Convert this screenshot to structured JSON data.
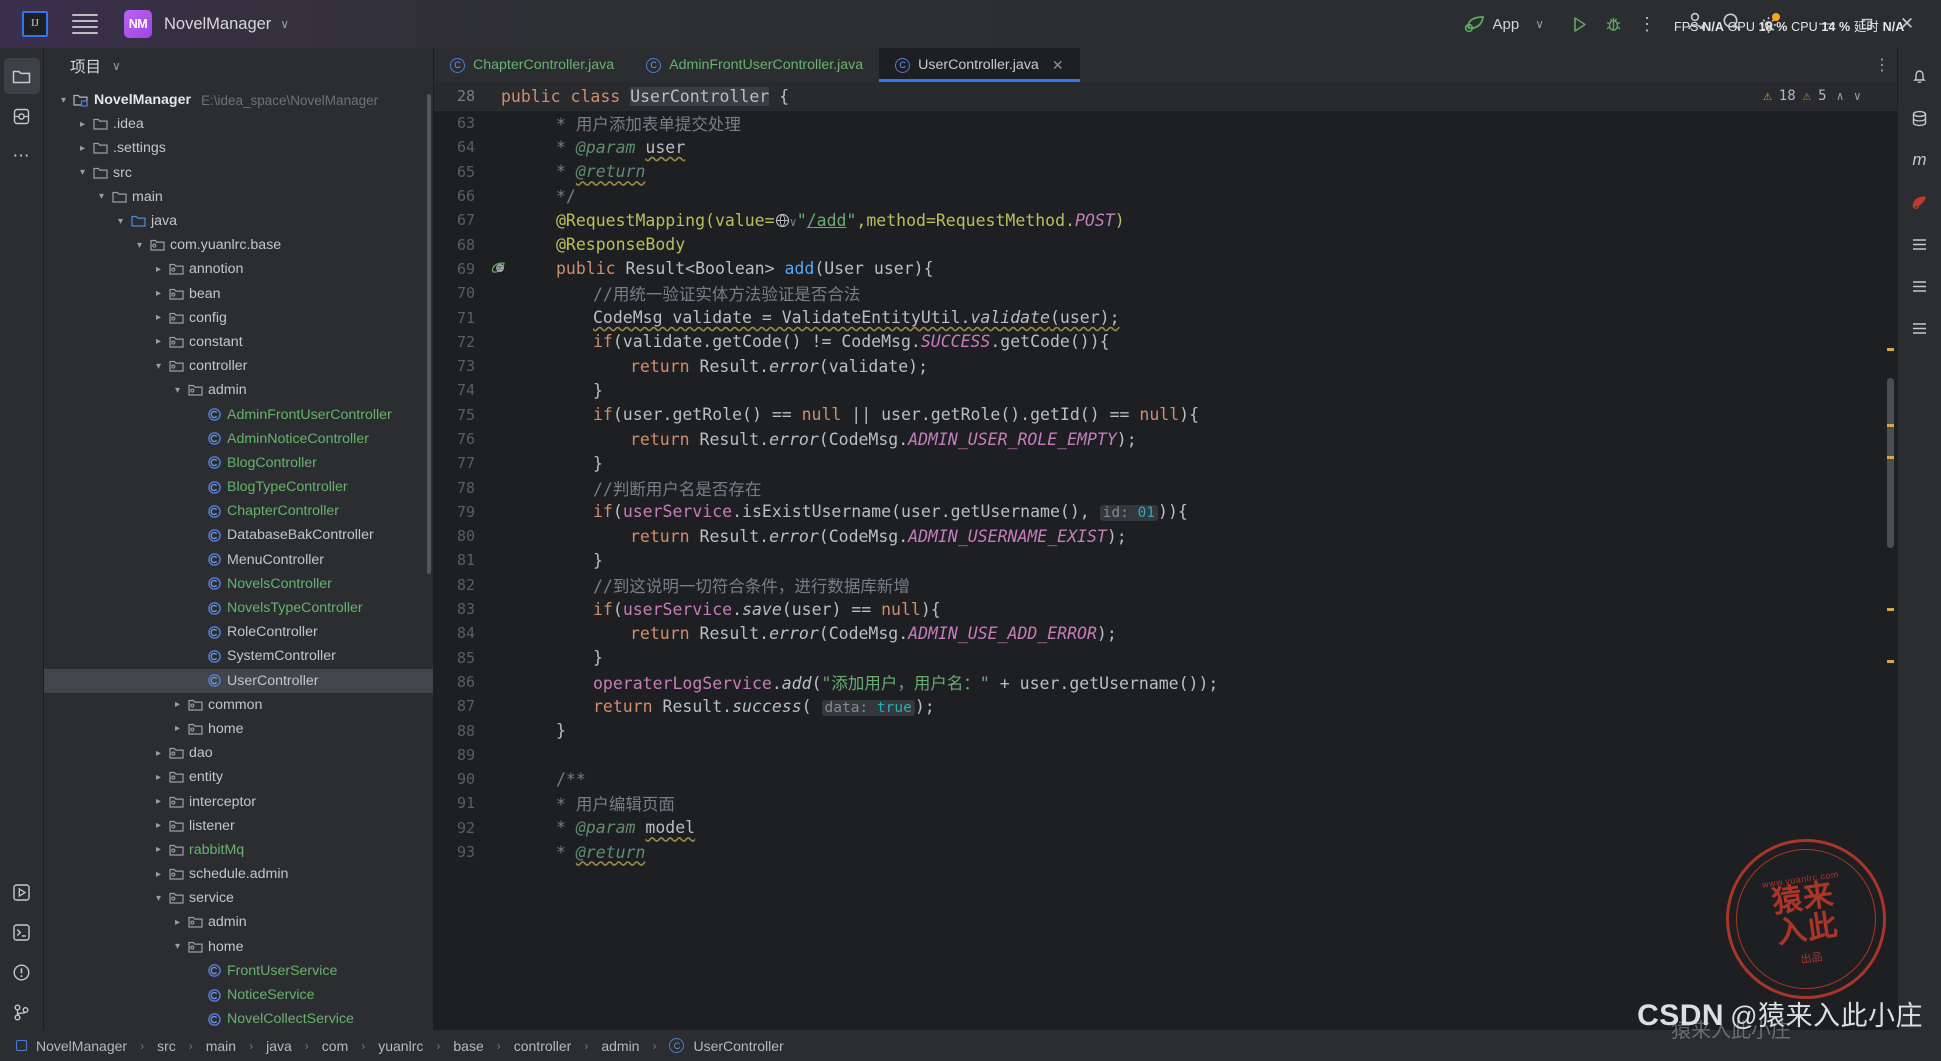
{
  "titlebar": {
    "logo_text": "IJ",
    "project_badge": "NM",
    "project_name": "NovelManager",
    "chevron": "∨",
    "run_config": "App",
    "stats": "FPS N/A GPU 18 % CPU 14 % 延时 N/A",
    "stats_parts": [
      {
        "label": "FPS",
        "value": "N/A"
      },
      {
        "label": "GPU",
        "value": "18 %"
      },
      {
        "label": "CPU",
        "value": "14 %"
      },
      {
        "label": "延时",
        "value": "N/A"
      }
    ],
    "window_minimize": "—",
    "window_maximize": "❐",
    "window_close": "✕",
    "more_actions": "⋮"
  },
  "project_panel": {
    "title": "项目",
    "chevron": "∨",
    "tree": [
      {
        "depth": 0,
        "arrow": "down",
        "icon": "module",
        "label": "NovelManager",
        "bold": true,
        "path": "E:\\idea_space\\NovelManager"
      },
      {
        "depth": 1,
        "arrow": "right",
        "icon": "folder",
        "label": ".idea"
      },
      {
        "depth": 1,
        "arrow": "right",
        "icon": "folder",
        "label": ".settings"
      },
      {
        "depth": 1,
        "arrow": "down",
        "icon": "folder",
        "label": "src"
      },
      {
        "depth": 2,
        "arrow": "down",
        "icon": "folder",
        "label": "main"
      },
      {
        "depth": 3,
        "arrow": "down",
        "icon": "folder-src",
        "label": "java"
      },
      {
        "depth": 4,
        "arrow": "down",
        "icon": "package",
        "label": "com.yuanlrc.base"
      },
      {
        "depth": 5,
        "arrow": "right",
        "icon": "package",
        "label": "annotion"
      },
      {
        "depth": 5,
        "arrow": "right",
        "icon": "package",
        "label": "bean"
      },
      {
        "depth": 5,
        "arrow": "right",
        "icon": "package",
        "label": "config"
      },
      {
        "depth": 5,
        "arrow": "right",
        "icon": "package",
        "label": "constant"
      },
      {
        "depth": 5,
        "arrow": "down",
        "icon": "package",
        "label": "controller"
      },
      {
        "depth": 6,
        "arrow": "down",
        "icon": "package",
        "label": "admin"
      },
      {
        "depth": 7,
        "arrow": "none",
        "icon": "class",
        "label": "AdminFrontUserController",
        "color": "green"
      },
      {
        "depth": 7,
        "arrow": "none",
        "icon": "class",
        "label": "AdminNoticeController",
        "color": "green"
      },
      {
        "depth": 7,
        "arrow": "none",
        "icon": "class",
        "label": "BlogController",
        "color": "green"
      },
      {
        "depth": 7,
        "arrow": "none",
        "icon": "class",
        "label": "BlogTypeController",
        "color": "green"
      },
      {
        "depth": 7,
        "arrow": "none",
        "icon": "class",
        "label": "ChapterController",
        "color": "green"
      },
      {
        "depth": 7,
        "arrow": "none",
        "icon": "class",
        "label": "DatabaseBakController",
        "color": "white"
      },
      {
        "depth": 7,
        "arrow": "none",
        "icon": "class",
        "label": "MenuController",
        "color": "white"
      },
      {
        "depth": 7,
        "arrow": "none",
        "icon": "class",
        "label": "NovelsController",
        "color": "green"
      },
      {
        "depth": 7,
        "arrow": "none",
        "icon": "class",
        "label": "NovelsTypeController",
        "color": "green"
      },
      {
        "depth": 7,
        "arrow": "none",
        "icon": "class",
        "label": "RoleController",
        "color": "white"
      },
      {
        "depth": 7,
        "arrow": "none",
        "icon": "class",
        "label": "SystemController",
        "color": "white"
      },
      {
        "depth": 7,
        "arrow": "none",
        "icon": "class",
        "label": "UserController",
        "color": "white",
        "selected": true
      },
      {
        "depth": 6,
        "arrow": "right",
        "icon": "package",
        "label": "common"
      },
      {
        "depth": 6,
        "arrow": "right",
        "icon": "package",
        "label": "home"
      },
      {
        "depth": 5,
        "arrow": "right",
        "icon": "package",
        "label": "dao"
      },
      {
        "depth": 5,
        "arrow": "right",
        "icon": "package",
        "label": "entity"
      },
      {
        "depth": 5,
        "arrow": "right",
        "icon": "package",
        "label": "interceptor"
      },
      {
        "depth": 5,
        "arrow": "right",
        "icon": "package",
        "label": "listener"
      },
      {
        "depth": 5,
        "arrow": "right",
        "icon": "package",
        "label": "rabbitMq",
        "color": "green"
      },
      {
        "depth": 5,
        "arrow": "right",
        "icon": "package",
        "label": "schedule.admin"
      },
      {
        "depth": 5,
        "arrow": "down",
        "icon": "package",
        "label": "service"
      },
      {
        "depth": 6,
        "arrow": "right",
        "icon": "package",
        "label": "admin"
      },
      {
        "depth": 6,
        "arrow": "down",
        "icon": "package",
        "label": "home"
      },
      {
        "depth": 7,
        "arrow": "none",
        "icon": "class",
        "label": "FrontUserService",
        "color": "green"
      },
      {
        "depth": 7,
        "arrow": "none",
        "icon": "class",
        "label": "NoticeService",
        "color": "green"
      },
      {
        "depth": 7,
        "arrow": "none",
        "icon": "class",
        "label": "NovelCollectService",
        "color": "green"
      }
    ]
  },
  "editor": {
    "tabs": [
      {
        "label": "ChapterController.java",
        "active": false,
        "color": "green"
      },
      {
        "label": "AdminFrontUserController.java",
        "active": false,
        "color": "green"
      },
      {
        "label": "UserController.java",
        "active": true,
        "color": "plain",
        "close": "✕"
      }
    ],
    "tab_more": "⋮",
    "sticky_header": {
      "line_number": "28",
      "text": "public class UserController {"
    },
    "inspections": {
      "warning_icon": "⚠",
      "warning_count": "18",
      "weak_warning_icon": "⚠",
      "weak_warning_count": "5",
      "up_arrow": "∧",
      "down_arrow": "∨"
    },
    "code_lines": [
      {
        "n": "63",
        "indent": 1,
        "type": "comment",
        "text": "* 用户添加表单提交处理",
        "faded": true
      },
      {
        "n": "64",
        "indent": 1,
        "type": "comment-param",
        "text": "* @param user"
      },
      {
        "n": "65",
        "indent": 1,
        "type": "comment-return",
        "text": "* @return"
      },
      {
        "n": "66",
        "indent": 1,
        "type": "comment",
        "text": "*/"
      },
      {
        "n": "67",
        "indent": 1,
        "type": "annotation",
        "text": "@RequestMapping(value=\"/add\",method=RequestMethod.POST)"
      },
      {
        "n": "68",
        "indent": 1,
        "type": "annotation",
        "text": "@ResponseBody"
      },
      {
        "n": "69",
        "indent": 1,
        "type": "method-decl",
        "text": "public Result<Boolean> add(User user){",
        "gutter": "web-run"
      },
      {
        "n": "70",
        "indent": 2,
        "type": "comment-cn",
        "text": "//用统一验证实体方法验证是否合法"
      },
      {
        "n": "71",
        "indent": 2,
        "type": "code",
        "text": "CodeMsg validate = ValidateEntityUtil.validate(user);"
      },
      {
        "n": "72",
        "indent": 2,
        "type": "code",
        "text": "if(validate.getCode() != CodeMsg.SUCCESS.getCode()){"
      },
      {
        "n": "73",
        "indent": 3,
        "type": "code",
        "text": "return Result.error(validate);"
      },
      {
        "n": "74",
        "indent": 2,
        "type": "code",
        "text": "}"
      },
      {
        "n": "75",
        "indent": 2,
        "type": "code",
        "text": "if(user.getRole() == null || user.getRole().getId() == null){"
      },
      {
        "n": "76",
        "indent": 3,
        "type": "code",
        "text": "return Result.error(CodeMsg.ADMIN_USER_ROLE_EMPTY);"
      },
      {
        "n": "77",
        "indent": 2,
        "type": "code",
        "text": "}"
      },
      {
        "n": "78",
        "indent": 2,
        "type": "comment-cn",
        "text": "//判断用户名是否存在"
      },
      {
        "n": "79",
        "indent": 2,
        "type": "code",
        "text": "if(userService.isExistUsername(user.getUsername(), id: 01)){",
        "inlay": "id:",
        "inlay_val": "01"
      },
      {
        "n": "80",
        "indent": 3,
        "type": "code",
        "text": "return Result.error(CodeMsg.ADMIN_USERNAME_EXIST);"
      },
      {
        "n": "81",
        "indent": 2,
        "type": "code",
        "text": "}"
      },
      {
        "n": "82",
        "indent": 2,
        "type": "comment-cn",
        "text": "//到这说明一切符合条件，进行数据库新增"
      },
      {
        "n": "83",
        "indent": 2,
        "type": "code",
        "text": "if(userService.save(user) == null){"
      },
      {
        "n": "84",
        "indent": 3,
        "type": "code",
        "text": "return Result.error(CodeMsg.ADMIN_USE_ADD_ERROR);"
      },
      {
        "n": "85",
        "indent": 2,
        "type": "code",
        "text": "}"
      },
      {
        "n": "86",
        "indent": 2,
        "type": "code",
        "text": "operaterLogService.add(\"添加用户，用户名：\" + user.getUsername());"
      },
      {
        "n": "87",
        "indent": 2,
        "type": "code",
        "text": "return Result.success( data: true);",
        "inlay": "data:",
        "inlay_val": "true"
      },
      {
        "n": "88",
        "indent": 1,
        "type": "code",
        "text": "}"
      },
      {
        "n": "89",
        "indent": 0,
        "type": "code",
        "text": ""
      },
      {
        "n": "90",
        "indent": 1,
        "type": "comment",
        "text": "/**"
      },
      {
        "n": "91",
        "indent": 1,
        "type": "comment",
        "text": "* 用户编辑页面"
      },
      {
        "n": "92",
        "indent": 1,
        "type": "comment-param",
        "text": "* @param model"
      },
      {
        "n": "93",
        "indent": 1,
        "type": "comment-return",
        "text": "* @return"
      }
    ]
  },
  "statusbar": {
    "breadcrumb": [
      "NovelManager",
      "src",
      "main",
      "java",
      "com",
      "yuanlrc",
      "base",
      "controller",
      "admin",
      "UserController"
    ],
    "separator": "›"
  },
  "watermark": {
    "stamp_line1": "猿来",
    "stamp_line2": "入此",
    "stamp_url": "www.yuanlrc.com",
    "stamp_sub": "出品",
    "csdn_brand": "CSDN",
    "csdn_handle": "@猿来入此小庄",
    "ghost_text": "猿来入此小庄"
  },
  "colors": {
    "accent": "#3574f0",
    "bg_editor": "#1e1f22",
    "bg_panel": "#2b2d30",
    "selection": "#43454a",
    "green_file": "#68b26e",
    "keyword": "#cf8e6d",
    "string": "#6aab73",
    "annotation": "#bcbf5b",
    "field": "#c77dbb",
    "method": "#56a8f5",
    "number": "#2aacb8",
    "comment": "#7a7e85",
    "warning": "#d7a843"
  }
}
